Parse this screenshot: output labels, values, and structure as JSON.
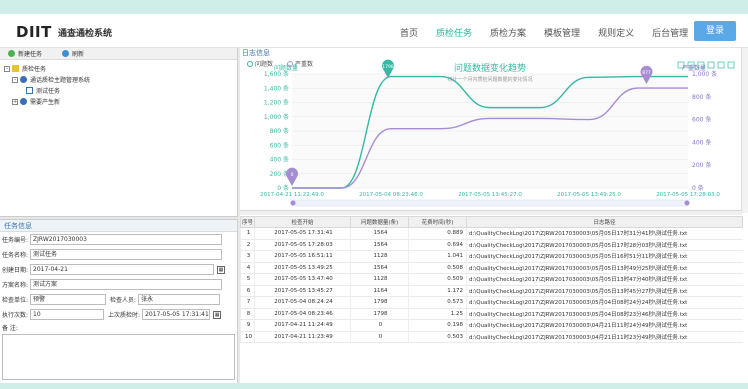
{
  "header": {
    "logo": "DIIT",
    "app_name": "通查通检系统",
    "nav": [
      "首页",
      "质检任务",
      "质检方案",
      "模板管理",
      "规则定义",
      "后台管理"
    ],
    "active_nav": 1,
    "login": "登录"
  },
  "toolbar": {
    "new_task": "新建任务",
    "refresh": "刷新"
  },
  "tree": {
    "root": "质检任务",
    "child1": "通话质检主题管理系统",
    "leaf": "测试任务",
    "child2": "需要产生新"
  },
  "form": {
    "title": "任务信息",
    "task_no_label": "任务编号:",
    "task_no": "ZJRW2017030003",
    "task_name_label": "任务名称:",
    "task_name": "测试任务",
    "created_label": "创建日期:",
    "created": "2017-04-21",
    "plan_label": "方案名称:",
    "plan": "测试方案",
    "unit_label": "检查单位:",
    "unit": "预警",
    "checker_label": "检查人员:",
    "checker": "张永",
    "runs_label": "执行次数:",
    "runs": "10",
    "last_label": "上次质检时:",
    "last": "2017-05-05 17:31:41",
    "remark_label": "备    注:"
  },
  "log_title": "日志信息",
  "chart_data": {
    "type": "line",
    "title": "问题数据变化趋势",
    "subtitle": "统计一个月内质检问题数据的变化情况",
    "legend": [
      "问题数",
      "严重数"
    ],
    "left_axis_label": "问题数量",
    "right_axis_label": "严重数量",
    "y_ticks_left": [
      "0 条",
      "200 条",
      "400 条",
      "600 条",
      "800 条",
      "1,000 条",
      "1,200 条",
      "1,400 条",
      "1,600 条"
    ],
    "y_ticks_right": [
      "0 条",
      "200 条",
      "400 条",
      "600 条",
      "800 条",
      "1,000 条"
    ],
    "x_ticks": [
      "2017-04-21 11:22:49.0",
      "2017-05-04 08:23:46.0",
      "2017-05-05 13:45:27.0",
      "2017-05-05 13:49:25.0",
      "2017-05-05 17:28:03.0"
    ],
    "series": [
      {
        "name": "问题数",
        "values": [
          0,
          0,
          1564,
          1564,
          1128,
          1128,
          1554,
          1564,
          1564
        ],
        "color": "#35b8a4"
      },
      {
        "name": "严重数",
        "values": [
          0,
          0,
          520,
          520,
          610,
          610,
          600,
          877,
          877
        ],
        "color": "#a68cd3"
      }
    ],
    "ylim_left": [
      0,
      1600
    ],
    "ylim_right": [
      0,
      1000
    ],
    "markers": [
      {
        "label": "1798",
        "color": "#35b8a4"
      },
      {
        "label": "877",
        "color": "#a68cd3"
      },
      {
        "label": "0",
        "color": "#a68cd3"
      }
    ]
  },
  "table": {
    "headers": [
      "序号",
      "检查开始",
      "问题数据量(条)",
      "花费时间(秒)",
      "日志路径"
    ],
    "rows": [
      [
        "1",
        "2017-05-05 17:31:41",
        "1564",
        "0.889",
        "d:\\QualityCheckLog\\2017\\ZJRW2017030003\\05月05日17时31分41秒\\测试任务.txt"
      ],
      [
        "2",
        "2017-05-05 17:28:03",
        "1564",
        "0.694",
        "d:\\QualityCheckLog\\2017\\ZJRW2017030003\\05月05日17时28分03秒\\测试任务.txt"
      ],
      [
        "3",
        "2017-05-05 16:51:11",
        "1128",
        "1.041",
        "d:\\QualityCheckLog\\2017\\ZJRW2017030003\\05月05日16时51分11秒\\测试任务.txt"
      ],
      [
        "4",
        "2017-05-05 13:49:25",
        "1564",
        "0.508",
        "d:\\QualityCheckLog\\2017\\ZJRW2017030003\\05月05日13时49分25秒\\测试任务.txt"
      ],
      [
        "5",
        "2017-05-05 13:47:40",
        "1128",
        "0.509",
        "d:\\QualityCheckLog\\2017\\ZJRW2017030003\\05月05日13时47分40秒\\测试任务.txt"
      ],
      [
        "6",
        "2017-05-05 13:45:27",
        "1164",
        "1.172",
        "d:\\QualityCheckLog\\2017\\ZJRW2017030003\\05月05日13时45分27秒\\测试任务.txt"
      ],
      [
        "7",
        "2017-05-04 08:24:24",
        "1798",
        "0.573",
        "d:\\QualityCheckLog\\2017\\ZJRW2017030003\\05月04日08时24分24秒\\测试任务.txt"
      ],
      [
        "8",
        "2017-05-04 08:23:46",
        "1798",
        "1.25",
        "d:\\QualityCheckLog\\2017\\ZJRW2017030003\\05月04日08时23分46秒\\测试任务.txt"
      ],
      [
        "9",
        "2017-04-21 11:24:49",
        "0",
        "0.198",
        "d:\\QualityCheckLog\\2017\\ZJRW2017030003\\04月21日11时24分49秒\\测试任务.txt"
      ],
      [
        "10",
        "2017-04-21 11:23:49",
        "0",
        "0.503",
        "d:\\QualityCheckLog\\2017\\ZJRW2017030003\\04月21日11时23分49秒\\测试任务.txt"
      ]
    ]
  }
}
